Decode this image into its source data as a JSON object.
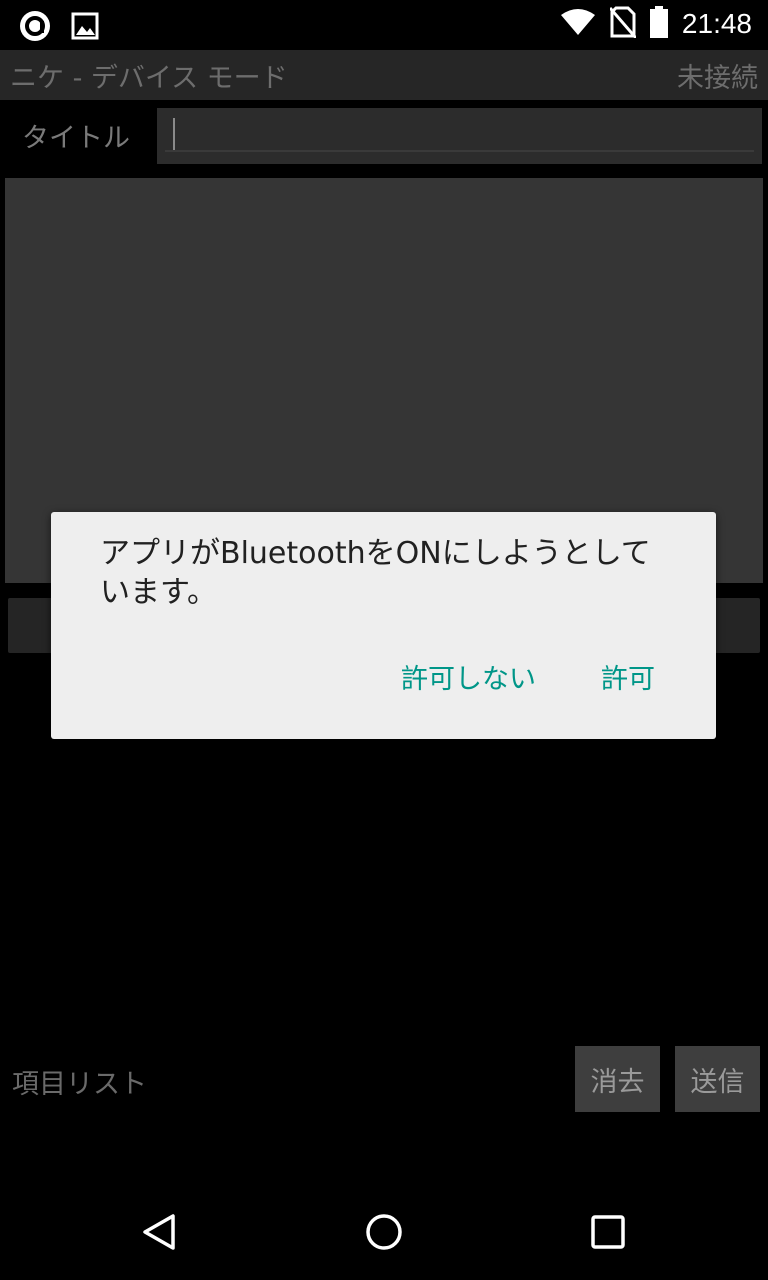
{
  "status_bar": {
    "time": "21:48",
    "left_icons": [
      "app-notification-icon",
      "image-notification-icon"
    ],
    "right_icons": [
      "wifi-icon",
      "no-sim-icon",
      "battery-icon"
    ]
  },
  "action_bar": {
    "title": "ニケ - デバイス モード",
    "connection_status": "未接続"
  },
  "form": {
    "title_label": "タイトル",
    "title_value": ""
  },
  "footer": {
    "list_label": "項目リスト",
    "clear_button": "消去",
    "send_button": "送信"
  },
  "dialog": {
    "message": "アプリがBluetoothをONにしようとしています。",
    "deny_button": "許可しない",
    "allow_button": "許可",
    "accent_color": "#009688"
  },
  "nav_bar": {
    "buttons": [
      "back-icon",
      "home-icon",
      "recents-icon"
    ]
  }
}
